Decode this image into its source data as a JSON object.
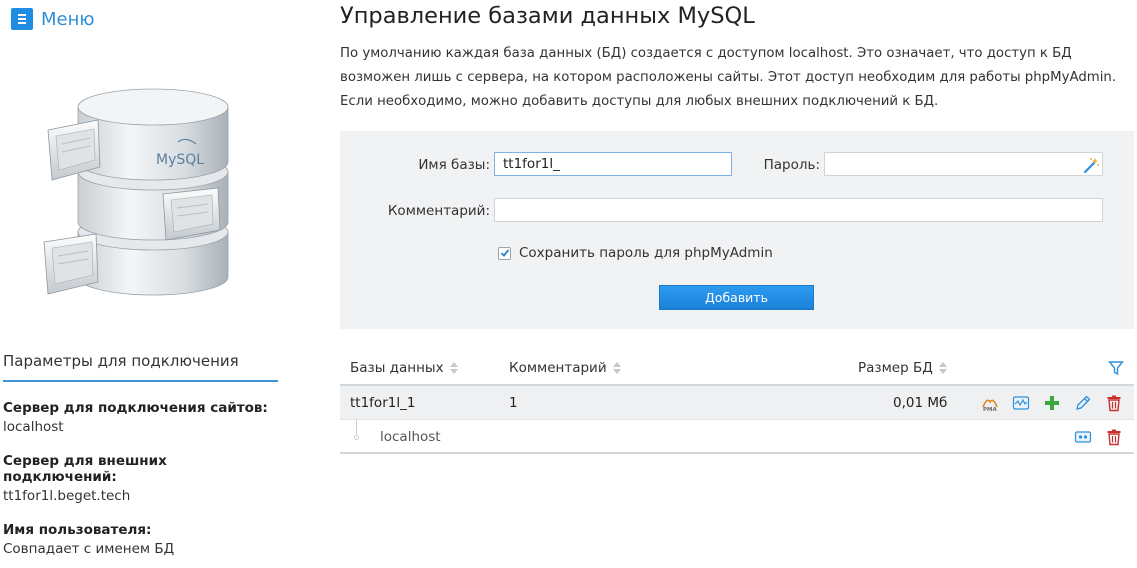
{
  "menu": {
    "label": "Меню"
  },
  "page": {
    "title": "Управление базами данных MySQL",
    "description": "По умолчанию каждая база данных (БД) создается с доступом localhost. Это означает, что доступ к БД возможен лишь с сервера, на котором расположены сайты. Этот доступ необходим для работы phpMyAdmin. Если необходимо, можно добавить доступы для любых внешних подключений к БД."
  },
  "illustration": {
    "logo_text": "MySQL"
  },
  "connection": {
    "title": "Параметры для подключения",
    "items": [
      {
        "label": "Сервер для подключения сайтов:",
        "value": "localhost"
      },
      {
        "label": "Сервер для внешних подключений:",
        "value": "tt1for1l.beget.tech"
      },
      {
        "label": "Имя пользователя:",
        "value": "Совпадает с именем БД"
      }
    ]
  },
  "form": {
    "db_name_label": "Имя базы:",
    "db_name_value": "tt1for1l_",
    "password_label": "Пароль:",
    "password_value": "",
    "comment_label": "Комментарий:",
    "comment_value": "",
    "save_pma_label": "Сохранить пароль для phpMyAdmin",
    "save_pma_checked": true,
    "add_button": "Добавить"
  },
  "table": {
    "headers": {
      "db": "Базы данных",
      "comment": "Комментарий",
      "size": "Размер БД"
    },
    "rows": [
      {
        "name": "tt1for1l_1",
        "comment": "1",
        "size": "0,01 Мб",
        "access": [
          {
            "host": "localhost"
          }
        ]
      }
    ]
  },
  "icons": {
    "filter": "filter-icon",
    "phpmyadmin": "phpmyadmin-icon",
    "monitor": "monitor-icon",
    "add": "add-access-icon",
    "edit": "edit-icon",
    "delete": "delete-icon",
    "access_info": "access-info-icon"
  },
  "colors": {
    "accent": "#1f8ee2",
    "button": "#1b82d8",
    "delete": "#c9302c",
    "add": "#3aa83a",
    "panel": "#f0f2f4"
  }
}
